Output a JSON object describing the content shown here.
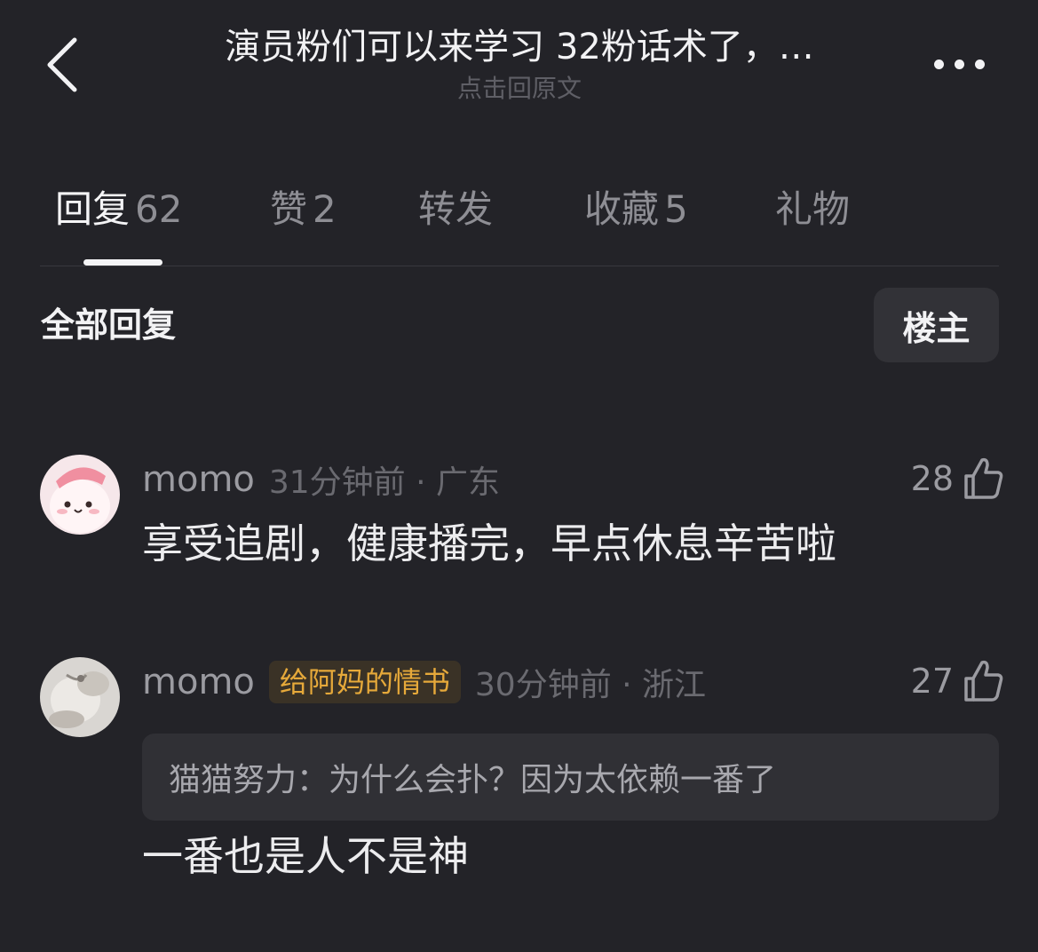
{
  "header": {
    "title": "演员粉们可以来学习 32粉话术了，…",
    "subtitle": "点击回原文"
  },
  "tabs": [
    {
      "label": "回复",
      "count": "62",
      "active": true
    },
    {
      "label": "赞",
      "count": "2",
      "active": false
    },
    {
      "label": "转发",
      "count": "",
      "active": false
    },
    {
      "label": "收藏",
      "count": "5",
      "active": false
    },
    {
      "label": "礼物",
      "count": "",
      "active": false
    }
  ],
  "section": {
    "title": "全部回复",
    "filter_label": "楼主"
  },
  "comments": [
    {
      "username": "momo",
      "badge": "",
      "time_location": "31分钟前 · 广东",
      "likes": "28",
      "quote": "",
      "text": "享受追剧，健康播完，早点休息辛苦啦"
    },
    {
      "username": "momo",
      "badge": "给阿妈的情书",
      "time_location": "30分钟前 · 浙江",
      "likes": "27",
      "quote": "猫猫努力：为什么会扑？因为太依赖一番了",
      "text": "一番也是人不是神"
    }
  ],
  "colors": {
    "background": "#232328",
    "badge_text": "#e6a93a",
    "badge_bg": "#3a3226",
    "filter_bg": "#323237"
  },
  "icons": {
    "back": "chevron-left-icon",
    "more": "more-horizontal-icon",
    "like": "thumbs-up-icon"
  }
}
